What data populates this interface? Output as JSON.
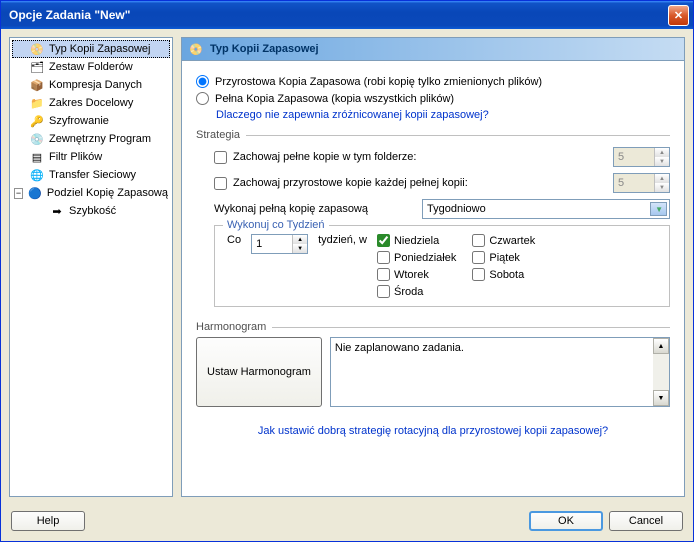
{
  "window_title": "Opcje Zadania \"New\"",
  "sidebar": {
    "items": [
      {
        "label": "Typ Kopii Zapasowej",
        "icon": "📀",
        "selected": true
      },
      {
        "label": "Zestaw Folderów",
        "icon": "🗂"
      },
      {
        "label": "Kompresja Danych",
        "icon": "📦"
      },
      {
        "label": "Zakres Docelowy",
        "icon": "📁"
      },
      {
        "label": "Szyfrowanie",
        "icon": "🔑"
      },
      {
        "label": "Zewnętrzny Program",
        "icon": "💿"
      },
      {
        "label": "Filtr Plików",
        "icon": "▤"
      },
      {
        "label": "Transfer Sieciowy",
        "icon": "🌐"
      },
      {
        "label": "Podziel Kopię Zapasową",
        "icon": "🔵",
        "expandable": true
      },
      {
        "label": "Szybkość",
        "icon": "➡",
        "child": true
      }
    ]
  },
  "header": {
    "title": "Typ Kopii Zapasowej"
  },
  "radios": {
    "incremental": "Przyrostowa Kopia Zapasowa (robi kopię tylko zmienionych plików)",
    "full": "Pełna Kopia Zapasowa (kopia wszystkich plików)",
    "selected": "incremental"
  },
  "link_why": "Dlaczego nie zapewnia zróżnicowanej kopii zapasowej?",
  "strategy": {
    "legend": "Strategia",
    "keep_full": {
      "label": "Zachowaj pełne kopie w tym folderze:",
      "value": "5",
      "checked": false
    },
    "keep_inc": {
      "label": "Zachowaj przyrostowe kopie każdej pełnej kopii:",
      "value": "5",
      "checked": false
    },
    "perform_full_label": "Wykonaj pełną kopię zapasową",
    "frequency_selected": "Tygodniowo",
    "week": {
      "legend": "Wykonuj co Tydzień",
      "every_label": "Co",
      "every_value": "1",
      "every_unit": "tydzień, w",
      "days": {
        "Niedziela": true,
        "Poniedziałek": false,
        "Wtorek": false,
        "Środa": false,
        "Czwartek": false,
        "Piątek": false,
        "Sobota": false
      }
    }
  },
  "schedule": {
    "legend": "Harmonogram",
    "button": "Ustaw Harmonogram",
    "status": "Nie zaplanowano zadania."
  },
  "link_rotation": "Jak ustawić dobrą strategię rotacyjną dla przyrostowej kopii zapasowej?",
  "buttons": {
    "help": "Help",
    "ok": "OK",
    "cancel": "Cancel"
  }
}
